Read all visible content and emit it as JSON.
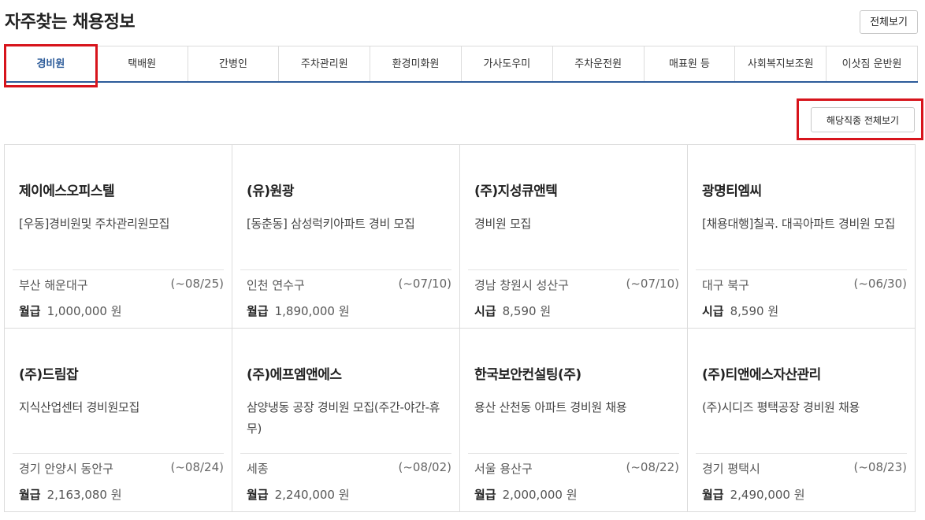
{
  "header": {
    "title": "자주찾는 채용정보",
    "view_all_label": "전체보기"
  },
  "tabs": [
    {
      "label": "경비원",
      "active": true
    },
    {
      "label": "택배원",
      "active": false
    },
    {
      "label": "간병인",
      "active": false
    },
    {
      "label": "주차관리원",
      "active": false
    },
    {
      "label": "환경미화원",
      "active": false
    },
    {
      "label": "가사도우미",
      "active": false
    },
    {
      "label": "주차운전원",
      "active": false
    },
    {
      "label": "매표원 등",
      "active": false
    },
    {
      "label": "사회복지보조원",
      "active": false
    },
    {
      "label": "이삿짐 운반원",
      "active": false
    }
  ],
  "occupation_view_all_label": "해당직종 전체보기",
  "colors": {
    "accent": "#2d5c9a",
    "highlight": "#d7141c",
    "border": "#dcdcdc"
  },
  "jobs": [
    {
      "company": "제이에스오피스텔",
      "title": "[우동]경비원및 주차관리원모집",
      "location": "부산 해운대구",
      "deadline": "(~08/25)",
      "pay_type": "월급",
      "pay_amount": "1,000,000 원"
    },
    {
      "company": "(유)원광",
      "title": "[동춘동] 삼성럭키아파트 경비 모집",
      "location": "인천 연수구",
      "deadline": "(~07/10)",
      "pay_type": "월급",
      "pay_amount": "1,890,000 원"
    },
    {
      "company": "(주)지성큐앤텍",
      "title": "경비원 모집",
      "location": "경남 창원시 성산구",
      "deadline": "(~07/10)",
      "pay_type": "시급",
      "pay_amount": "8,590 원"
    },
    {
      "company": "광명티엠씨",
      "title": "[채용대행]칠곡. 대곡아파트 경비원 모집",
      "location": "대구 북구",
      "deadline": "(~06/30)",
      "pay_type": "시급",
      "pay_amount": "8,590 원"
    },
    {
      "company": "(주)드림잡",
      "title": "지식산업센터 경비원모집",
      "location": "경기 안양시 동안구",
      "deadline": "(~08/24)",
      "pay_type": "월급",
      "pay_amount": "2,163,080 원"
    },
    {
      "company": "(주)에프엠앤에스",
      "title": "삼양냉동 공장 경비원 모집(주간-야간-휴무)",
      "location": "세종",
      "deadline": "(~08/02)",
      "pay_type": "월급",
      "pay_amount": "2,240,000 원"
    },
    {
      "company": "한국보안컨설팅(주)",
      "title": "용산 산천동 아파트 경비원 채용",
      "location": "서울 용산구",
      "deadline": "(~08/22)",
      "pay_type": "월급",
      "pay_amount": "2,000,000 원"
    },
    {
      "company": "(주)티앤에스자산관리",
      "title": "(주)시디즈 평택공장 경비원 채용",
      "location": "경기 평택시",
      "deadline": "(~08/23)",
      "pay_type": "월급",
      "pay_amount": "2,490,000 원"
    }
  ]
}
